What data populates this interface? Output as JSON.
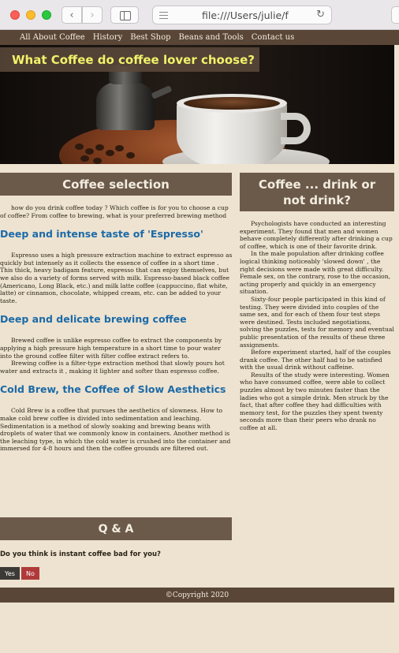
{
  "browser": {
    "address": "file:///Users/julie/f"
  },
  "nav": {
    "items": [
      "All About Coffee",
      "History",
      "Best Shop",
      "Beans and Tools",
      "Contact us"
    ]
  },
  "hero": {
    "title": "What Coffee do coffee lover choose?"
  },
  "left": {
    "header": "Coffee selection",
    "intro": "how do you drink coffee today ? Which coffee is for you to choose a cup of coffee? From coffee to brewing, what is your preferred brewing method",
    "sections": [
      {
        "title": "Deep and intense taste of 'Espresso'",
        "paragraphs": [
          "Espresso uses a high pressure extraction machine to extract espresso as quickly but intensely as it collects the essence of coffee in a short time . This thick, heavy badigam feature, espresso that can enjoy themselves, but we also do a variety of forms served with milk. Espresso-based black coffee (Americano, Long Black, etc.) and milk latte coffee (cappuccino, flat white, latte) or cinnamon, chocolate, whipped cream, etc. can be added to your taste."
        ]
      },
      {
        "title": "Deep and delicate brewing coffee",
        "paragraphs": [
          "Brewed coffee is unlike espresso coffee to extract the components by applying a high pressure high temperature in a short time to pour water into the ground coffee filter with filter coffee extract refers to.",
          "Brewing coffee is a filter-type extraction method that slowly pours hot water and extracts it , making it lighter and softer than espresso coffee."
        ]
      },
      {
        "title": "Cold Brew, the Coffee of Slow Aesthetics",
        "paragraphs": [
          "Cold Brew is a coffee that pursues the aesthetics of slowness. How to make cold brew coffee is divided into sedimentation and leaching. Sedimentation is a method of slowly soaking and brewing beans with droplets of water that we commonly know in containers. Another method is the leaching type, in which the cold water is crushed into the container and immersed for 4-8 hours and then the coffee grounds are filtered out."
        ]
      }
    ]
  },
  "right": {
    "header": "Coffee ... drink or not drink?",
    "paragraphs": [
      "Psychologists have conducted an interesting experiment. They found that men and women behave completely differently after drinking a cup of coffee, which is one of their favorite drink.",
      "In the male population after drinking coffee logical thinking noticeably 'slowed down' , the right decisions were made with great difficulty. Female sex, on the contrary, rose to the occasion, acting properly and quickly in an emergency situation.",
      "Sixty-four people participated in this kind of testing. They were divided into couples of the same sex, and for each of them four test steps were destined. Tests included negotiations, solving the puzzles, tests for memory and eventual public presentation of the results of these three assignments.",
      "Before experiment started, half of the couples drank coffee. The other half had to be satisfied with the usual drink without caffeine.",
      "Results of the study were interesting. Women who have consumed coffee, were able to collect puzzles almost by two minutes faster than the ladies who got a simple drink. Men struck by the fact, that after coffee they had difficulties with memory test, for the puzzles they spent twenty seconds more than their peers who drank no coffee at all."
    ]
  },
  "qa": {
    "header": "Q & A",
    "question": "Do you think is instant coffee bad for you?",
    "yes_label": "Yes",
    "no_label": "No"
  },
  "footer": {
    "text": "©Copyright 2020"
  },
  "colors": {
    "background": "#ede3d0",
    "nav_bg": "#5a4637",
    "section_header_bg": "#6b5a4a",
    "subheading": "#1c6aa8",
    "hero_title": "#f2f26a",
    "no_button": "#b03a3a"
  }
}
